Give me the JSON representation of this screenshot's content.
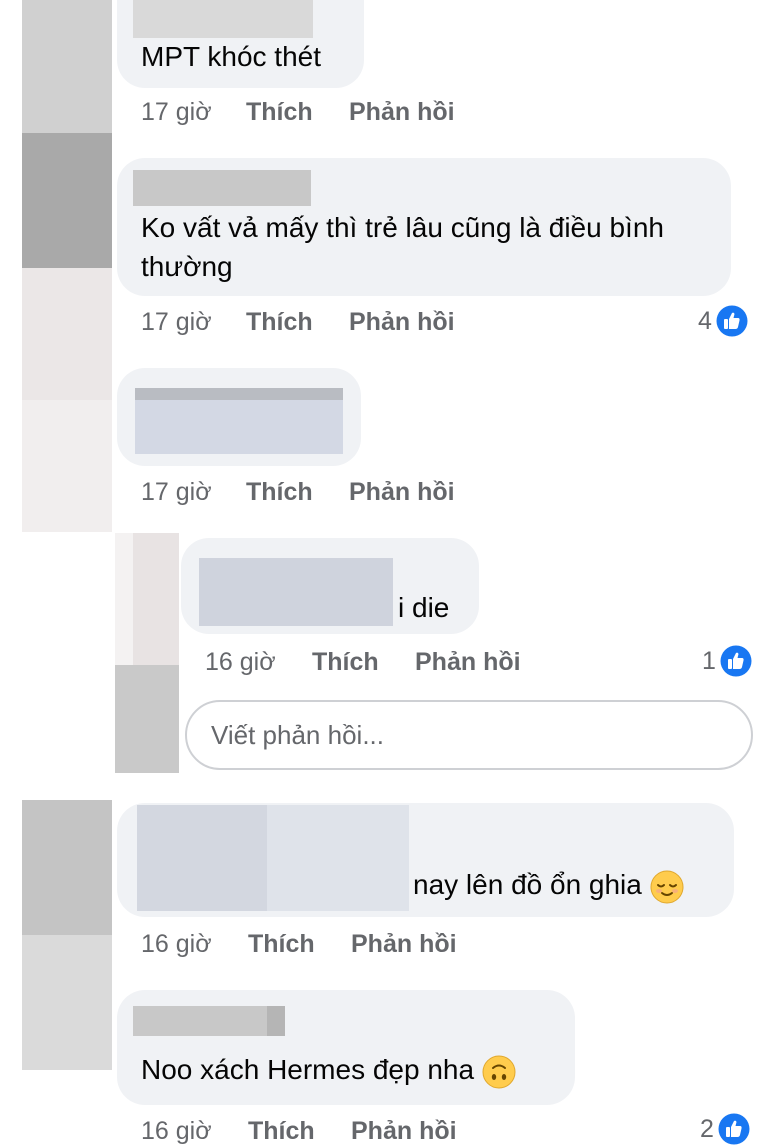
{
  "comments": [
    {
      "text": "MPT khóc thét",
      "time": "17 giờ",
      "like_label": "Thích",
      "reply_label": "Phản hồi",
      "likes": ""
    },
    {
      "text_line1": "Ko vất vả mấy thì trẻ lâu cũng là điều bình",
      "text_line2": "thường",
      "time": "17 giờ",
      "like_label": "Thích",
      "reply_label": "Phản hồi",
      "likes": "4"
    },
    {
      "text": "",
      "time": "17 giờ",
      "like_label": "Thích",
      "reply_label": "Phản hồi",
      "likes": ""
    },
    {
      "text": "i die",
      "time": "16 giờ",
      "like_label": "Thích",
      "reply_label": "Phản hồi",
      "likes": "1"
    },
    {
      "text": "nay lên đồ ổn ghia",
      "emoji": "relieved-face",
      "time": "16 giờ",
      "like_label": "Thích",
      "reply_label": "Phản hồi",
      "likes": ""
    },
    {
      "text": "Noo xách Hermes đẹp nha",
      "emoji": "upside-down-face",
      "time": "16 giờ",
      "like_label": "Thích",
      "reply_label": "Phản hồi",
      "likes": "2"
    }
  ],
  "reply_input": {
    "placeholder": "Viết phản hồi..."
  },
  "icons": {
    "like": "thumbs-up-like-icon"
  },
  "colors": {
    "like_blue": "#1877f2",
    "bubble": "#f0f2f5",
    "meta": "#65676b"
  }
}
